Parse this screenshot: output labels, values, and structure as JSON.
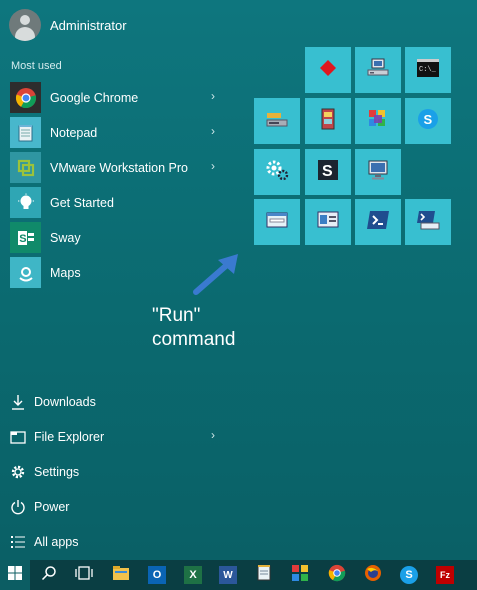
{
  "user": {
    "name": "Administrator"
  },
  "section_label": "Most used",
  "apps": [
    {
      "label": "Google Chrome",
      "icon": "chrome-icon",
      "has_submenu": true,
      "color": "#2d2d2d"
    },
    {
      "label": "Notepad",
      "icon": "notepad-icon",
      "has_submenu": true,
      "color": "#48b7cc"
    },
    {
      "label": "VMware Workstation Pro",
      "icon": "vmware-icon",
      "has_submenu": true,
      "color": "#2f96a2"
    },
    {
      "label": "Get Started",
      "icon": "lightbulb-icon",
      "has_submenu": false,
      "color": "#2fa6b4"
    },
    {
      "label": "Sway",
      "icon": "sway-icon",
      "has_submenu": false,
      "color": "#108a6a"
    },
    {
      "label": "Maps",
      "icon": "maps-icon",
      "has_submenu": false,
      "color": "#3fb6c6"
    }
  ],
  "places": [
    {
      "label": "Downloads",
      "icon": "download-icon",
      "has_submenu": false
    },
    {
      "label": "File Explorer",
      "icon": "folder-icon",
      "has_submenu": true
    },
    {
      "label": "Settings",
      "icon": "gear-icon",
      "has_submenu": false
    },
    {
      "label": "Power",
      "icon": "power-icon",
      "has_submenu": false
    },
    {
      "label": "All apps",
      "icon": "list-icon",
      "has_submenu": false
    }
  ],
  "tiles": [
    {
      "icon": "red-diamond-icon"
    },
    {
      "icon": "computer-network-icon"
    },
    {
      "icon": "command-prompt-icon"
    },
    {
      "icon": "drive-icon"
    },
    {
      "icon": "registry-icon"
    },
    {
      "icon": "color-app-icon"
    },
    {
      "icon": "skype-icon"
    },
    {
      "icon": "services-gear-icon"
    },
    {
      "icon": "sway-s-icon"
    },
    {
      "icon": "monitor-icon"
    },
    {
      "icon": "run-dialog-icon"
    },
    {
      "icon": "control-panel-icon"
    },
    {
      "icon": "powershell-icon"
    },
    {
      "icon": "powershell-ise-icon"
    }
  ],
  "annotation": {
    "line1": "\"Run\"",
    "line2": "command",
    "color": "#3a7ad0"
  },
  "taskbar": [
    {
      "icon": "windows-start-icon"
    },
    {
      "icon": "search-icon"
    },
    {
      "icon": "task-view-icon"
    },
    {
      "icon": "file-explorer-icon"
    },
    {
      "icon": "outlook-icon",
      "label": "O"
    },
    {
      "icon": "excel-icon",
      "label": "X"
    },
    {
      "icon": "word-icon",
      "label": "W"
    },
    {
      "icon": "notepad-icon"
    },
    {
      "icon": "paint-icon"
    },
    {
      "icon": "chrome-icon"
    },
    {
      "icon": "firefox-icon"
    },
    {
      "icon": "skype-icon",
      "label": "S"
    },
    {
      "icon": "filezilla-icon",
      "label": "Fz"
    }
  ]
}
